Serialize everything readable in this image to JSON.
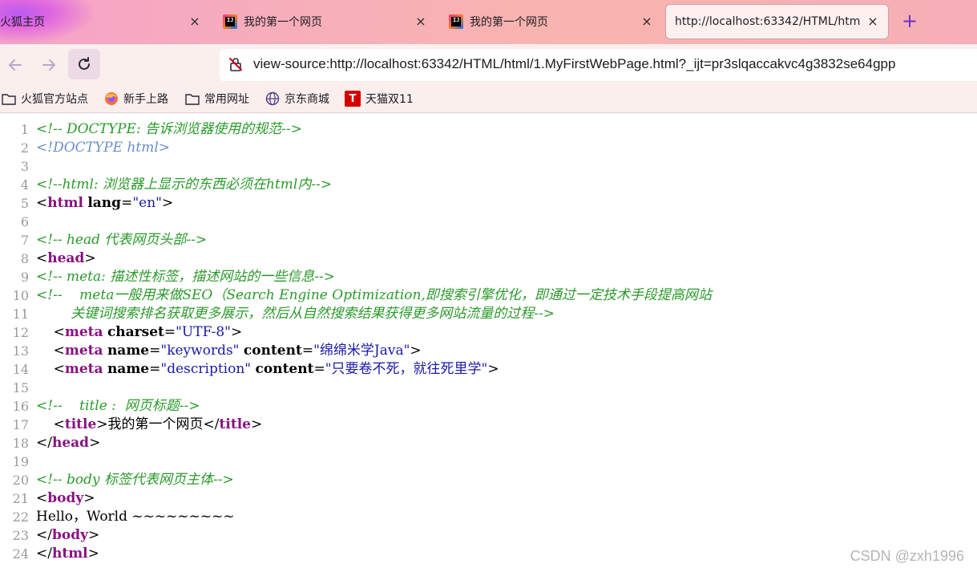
{
  "tabs": [
    {
      "title": "火狐主页",
      "close": "×"
    },
    {
      "title": "我的第一个网页",
      "close": "×"
    },
    {
      "title": "我的第一个网页",
      "close": "×"
    },
    {
      "title": "http://localhost:63342/HTML/htm",
      "close": "×"
    }
  ],
  "new_tab": "+",
  "url": "view-source:http://localhost:63342/HTML/html/1.MyFirstWebPage.html?_ijt=pr3slqaccakvc4g3832se64gpp",
  "bookmarks": [
    {
      "label": "火狐官方站点",
      "icon": "folder-icon"
    },
    {
      "label": "新手上路",
      "icon": "firefox-icon"
    },
    {
      "label": "常用网址",
      "icon": "folder-icon"
    },
    {
      "label": "京东商城",
      "icon": "globe-icon"
    },
    {
      "label": "天猫双11",
      "icon": "tmall-icon"
    }
  ],
  "source": {
    "line_numbers": [
      "1",
      "2",
      "3",
      "4",
      "5",
      "6",
      "7",
      "8",
      "9",
      "10",
      "11",
      "12",
      "13",
      "14",
      "15",
      "16",
      "17",
      "18",
      "19",
      "20",
      "21",
      "22",
      "23",
      "24"
    ],
    "l1": "<!-- DOCTYPE: 告诉浏览器使用的规范-->",
    "l2": "<!DOCTYPE html>",
    "l4": "<!--html: 浏览器上显示的东西必须在html内-->",
    "l7": "<!-- head 代表网页头部-->",
    "l9": "<!-- meta: 描述性标签，描述网站的一些信息-->",
    "l10": "<!--    meta一般用来做SEO（Search Engine Optimization,即搜索引擎优化，即通过一定技术手段提高网站",
    "l11": "        关键词搜索排名获取更多展示，然后从自然搜索结果获得更多网站流量的过程-->",
    "l16": "<!--    title :  网页标题-->",
    "l20": "<!-- body 标签代表网页主体-->",
    "tag_html": "html",
    "tag_head": "head",
    "tag_meta": "meta",
    "tag_title": "title",
    "tag_body": "body",
    "attr_lang": "lang",
    "val_lang": "\"en\"",
    "attr_charset": "charset",
    "val_charset": "\"UTF-8\"",
    "attr_name": "name",
    "val_keywords": "\"keywords\"",
    "attr_content": "content",
    "val_content1": "\"绵绵米学Java\"",
    "val_description": "\"description\"",
    "val_content2": "\"只要卷不死，就往死里学\"",
    "title_text": "我的第一个网页",
    "body_text": "Hello，World ~~~~~~~~~"
  },
  "watermark": "CSDN @zxh1996",
  "colors": {
    "comment": "#2a9a2a",
    "tag": "#881280",
    "value": "#1a1aa6",
    "doctype": "#6a8fc8"
  }
}
